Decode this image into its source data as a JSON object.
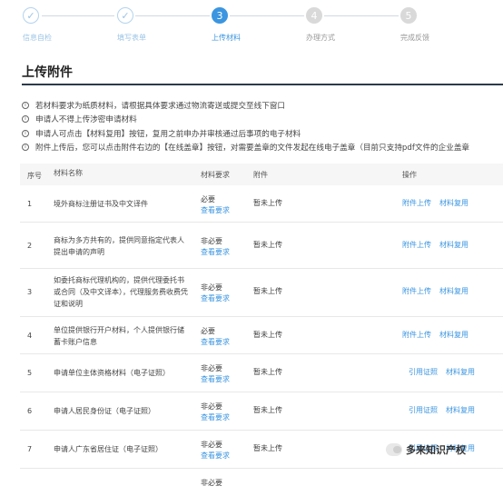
{
  "steps": [
    {
      "label": "信息自检",
      "state": "done",
      "mark": "✓"
    },
    {
      "label": "填写表单",
      "state": "done",
      "mark": "✓"
    },
    {
      "label": "上传材料",
      "state": "active",
      "mark": "3"
    },
    {
      "label": "办理方式",
      "state": "todo",
      "mark": "4"
    },
    {
      "label": "完成反馈",
      "state": "todo",
      "mark": "5"
    }
  ],
  "section_title": "上传附件",
  "notes": [
    "若材料要求为纸质材料，请根据具体要求通过物流寄送或提交至线下窗口",
    "申请人不得上传涉密申请材料",
    "申请人可点击【材料复用】按钮，复用之前申办并审核通过后事项的电子材料",
    "附件上传后，您可以点击附件右边的【在线盖章】按钮，对需要盖章的文件发起在线电子盖章（目前只支持pdf文件的企业盖章"
  ],
  "table": {
    "headers": {
      "no": "序号",
      "name": "材料名称",
      "req": "材料要求",
      "att": "附件",
      "ops": "操作"
    },
    "rows": [
      {
        "no": "1",
        "name": "境外商标注册证书及中文译件",
        "req": "必要",
        "req_link": "查看要求",
        "att": "暂未上传",
        "op1": "附件上传",
        "op2": "材料复用"
      },
      {
        "no": "2",
        "name": "商标为多方共有的，提供同意指定代表人提出申请的声明",
        "req": "非必要",
        "req_link": "查看要求",
        "att": "暂未上传",
        "op1": "附件上传",
        "op2": "材料复用"
      },
      {
        "no": "3",
        "name": "如委托商标代理机构的，提供代理委托书或合同（及中文译本），代理服务费收费凭证和说明",
        "req": "非必要",
        "req_link": "查看要求",
        "att": "暂未上传",
        "op1": "附件上传",
        "op2": "材料复用"
      },
      {
        "no": "4",
        "name": "单位提供银行开户材料，个人提供银行储蓄卡账户信息",
        "req": "必要",
        "req_link": "查看要求",
        "att": "暂未上传",
        "op1": "附件上传",
        "op2": "材料复用"
      },
      {
        "no": "5",
        "name": "申请单位主体资格材料（电子证照）",
        "req": "非必要",
        "req_link": "查看要求",
        "att": "暂未上传",
        "op1": "引用证照",
        "op2": "材料复用"
      },
      {
        "no": "6",
        "name": "申请人居民身份证（电子证照）",
        "req": "非必要",
        "req_link": "查看要求",
        "att": "暂未上传",
        "op1": "引用证照",
        "op2": "材料复用"
      },
      {
        "no": "7",
        "name": "申请人广东省居住证（电子证照）",
        "req": "非必要",
        "req_link": "查看要求",
        "att": "暂未上传",
        "op1": "引用证照",
        "op2": "材料复用"
      },
      {
        "no": "",
        "name": "",
        "req": "非必要",
        "req_link": "",
        "att": "",
        "op1": "",
        "op2": ""
      }
    ]
  },
  "watermark": "多来知识产权"
}
